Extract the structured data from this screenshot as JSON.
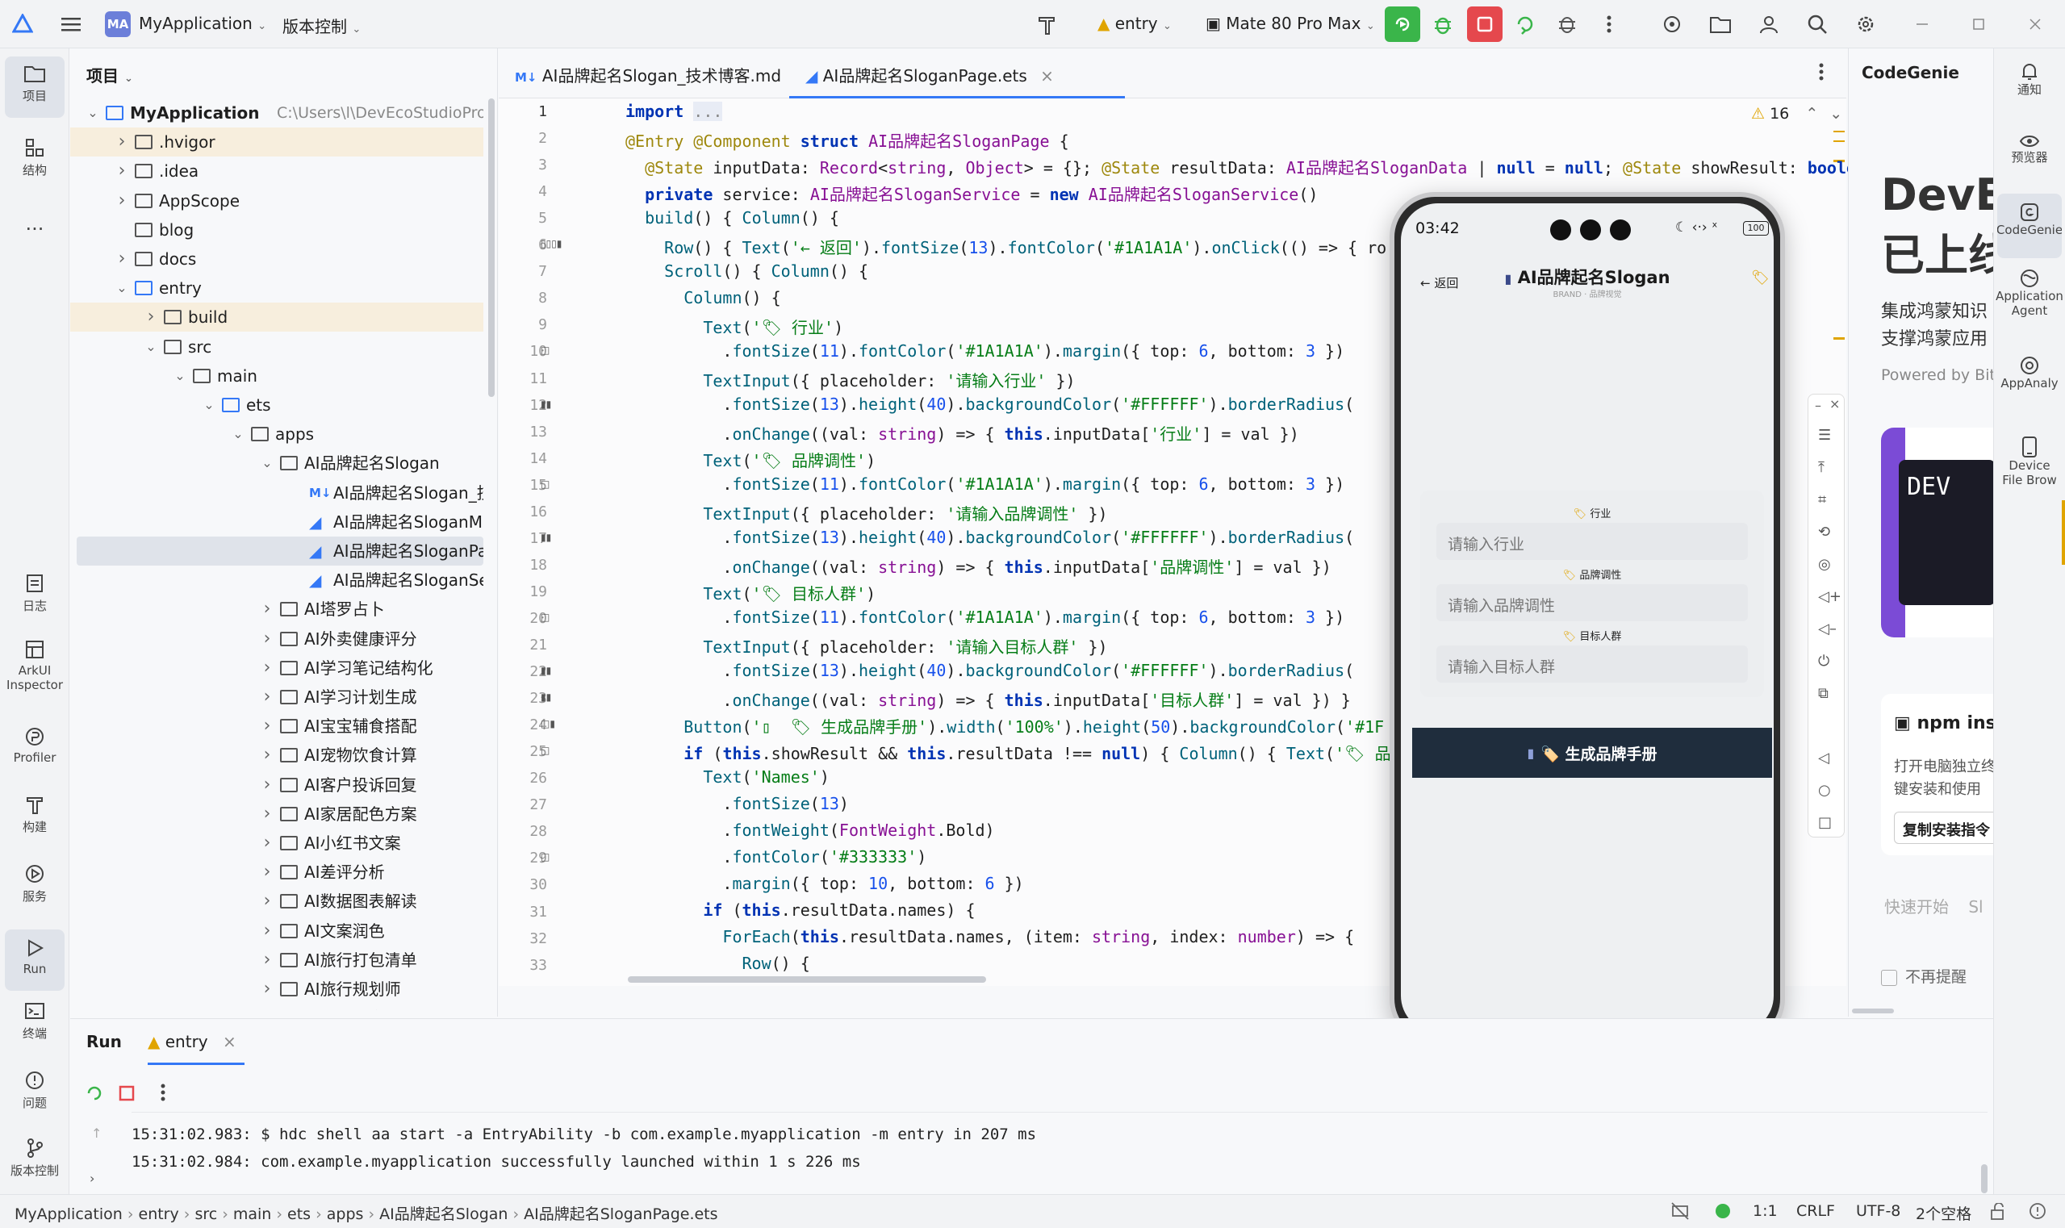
{
  "topbar": {
    "logo": "MA",
    "app_name": "MyApplication",
    "vcs": "版本控制",
    "run_config": "entry",
    "device": "Mate 80 Pro Max"
  },
  "leftbar": {
    "items": [
      "项目",
      "结构",
      "日志",
      "ArkUI Inspector",
      "Profiler",
      "构建",
      "服务",
      "Run",
      "终端",
      "问题",
      "版本控制"
    ]
  },
  "project": {
    "header": "项目",
    "tree": [
      {
        "label": "MyApplication",
        "path": "C:\\Users\\l\\DevEcoStudioProjects\\My"
      },
      {
        "label": ".hvigor"
      },
      {
        "label": ".idea"
      },
      {
        "label": "AppScope"
      },
      {
        "label": "blog"
      },
      {
        "label": "docs"
      },
      {
        "label": "entry"
      },
      {
        "label": "build"
      },
      {
        "label": "src"
      },
      {
        "label": "main"
      },
      {
        "label": "ets"
      },
      {
        "label": "apps"
      },
      {
        "label": "AI品牌起名Slogan"
      },
      {
        "label": "AI品牌起名Slogan_技术博客.md"
      },
      {
        "label": "AI品牌起名SloganModel.ets"
      },
      {
        "label": "AI品牌起名SloganPage.ets"
      },
      {
        "label": "AI品牌起名SloganService.ets"
      },
      {
        "label": "AI塔罗占卜"
      },
      {
        "label": "AI外卖健康评分"
      },
      {
        "label": "AI学习笔记结构化"
      },
      {
        "label": "AI学习计划生成"
      },
      {
        "label": "AI宝宝辅食搭配"
      },
      {
        "label": "AI宠物饮食计算"
      },
      {
        "label": "AI客户投诉回复"
      },
      {
        "label": "AI家居配色方案"
      },
      {
        "label": "AI小红书文案"
      },
      {
        "label": "AI差评分析"
      },
      {
        "label": "AI数据图表解读"
      },
      {
        "label": "AI文案润色"
      },
      {
        "label": "AI旅行打包清单"
      },
      {
        "label": "AI旅行规划师"
      },
      {
        "label": "AI朋友圈文案"
      }
    ]
  },
  "tabs": [
    {
      "badge": "M↓",
      "label": "AI品牌起名Slogan_技术博客.md"
    },
    {
      "label": "AI品牌起名SloganPage.ets",
      "close": "×"
    }
  ],
  "editor": {
    "warnings": "16",
    "line_numbers": [
      "1",
      "2",
      "3",
      "4",
      "5",
      "6",
      "7",
      "8",
      "9",
      "10",
      "11",
      "12",
      "13",
      "14",
      "15",
      "16",
      "17",
      "18",
      "19",
      "20",
      "21",
      "22",
      "23",
      "24",
      "25",
      "26",
      "27",
      "28",
      "29",
      "30",
      "31",
      "32",
      "33"
    ]
  },
  "phone": {
    "time": "03:42",
    "battery": "100",
    "back": "← 返回",
    "title": "AI品牌起名Slogan",
    "subtitle": "BRAND · 品牌视觉",
    "label1": "行业",
    "placeholder1": "请输入行业",
    "label2": "品牌调性",
    "placeholder2": "请输入品牌调性",
    "label3": "目标人群",
    "placeholder3": "请输入目标人群",
    "button": "🏷️ 生成品牌手册"
  },
  "rightpanel": {
    "title": "CodeGenie",
    "big1": "DevEc",
    "big2": "已上线",
    "desc1": "集成鸿蒙知识",
    "desc2": "支撑鸿蒙应用",
    "powered": "Powered by BitFu",
    "npm": "npm ins",
    "npm_desc1": "打开电脑独立终",
    "npm_desc2": "键安装和使用",
    "copy_btn": "复制安装指令",
    "quick": "快速开始",
    "quick2": "Sl",
    "no_remind": "不再提醒"
  },
  "rightbar": {
    "items": [
      "通知",
      "预览器",
      "CodeGenie",
      "Application Agent",
      "AppAnaly",
      "Device File Brow"
    ]
  },
  "run": {
    "title": "Run",
    "tab": "entry",
    "lines": [
      "15:31:02.983: $ hdc shell aa start -a EntryAbility -b com.example.myapplication -m entry in 207 ms",
      "15:31:02.984: com.example.myapplication successfully launched within 1 s 226 ms"
    ]
  },
  "status": {
    "crumbs": [
      "MyApplication",
      "entry",
      "src",
      "main",
      "ets",
      "apps",
      "AI品牌起名Slogan",
      "AI品牌起名SloganPage.ets"
    ],
    "position": "1:1",
    "line_ending": "CRLF",
    "encoding": "UTF-8",
    "indent": "2个空格"
  }
}
